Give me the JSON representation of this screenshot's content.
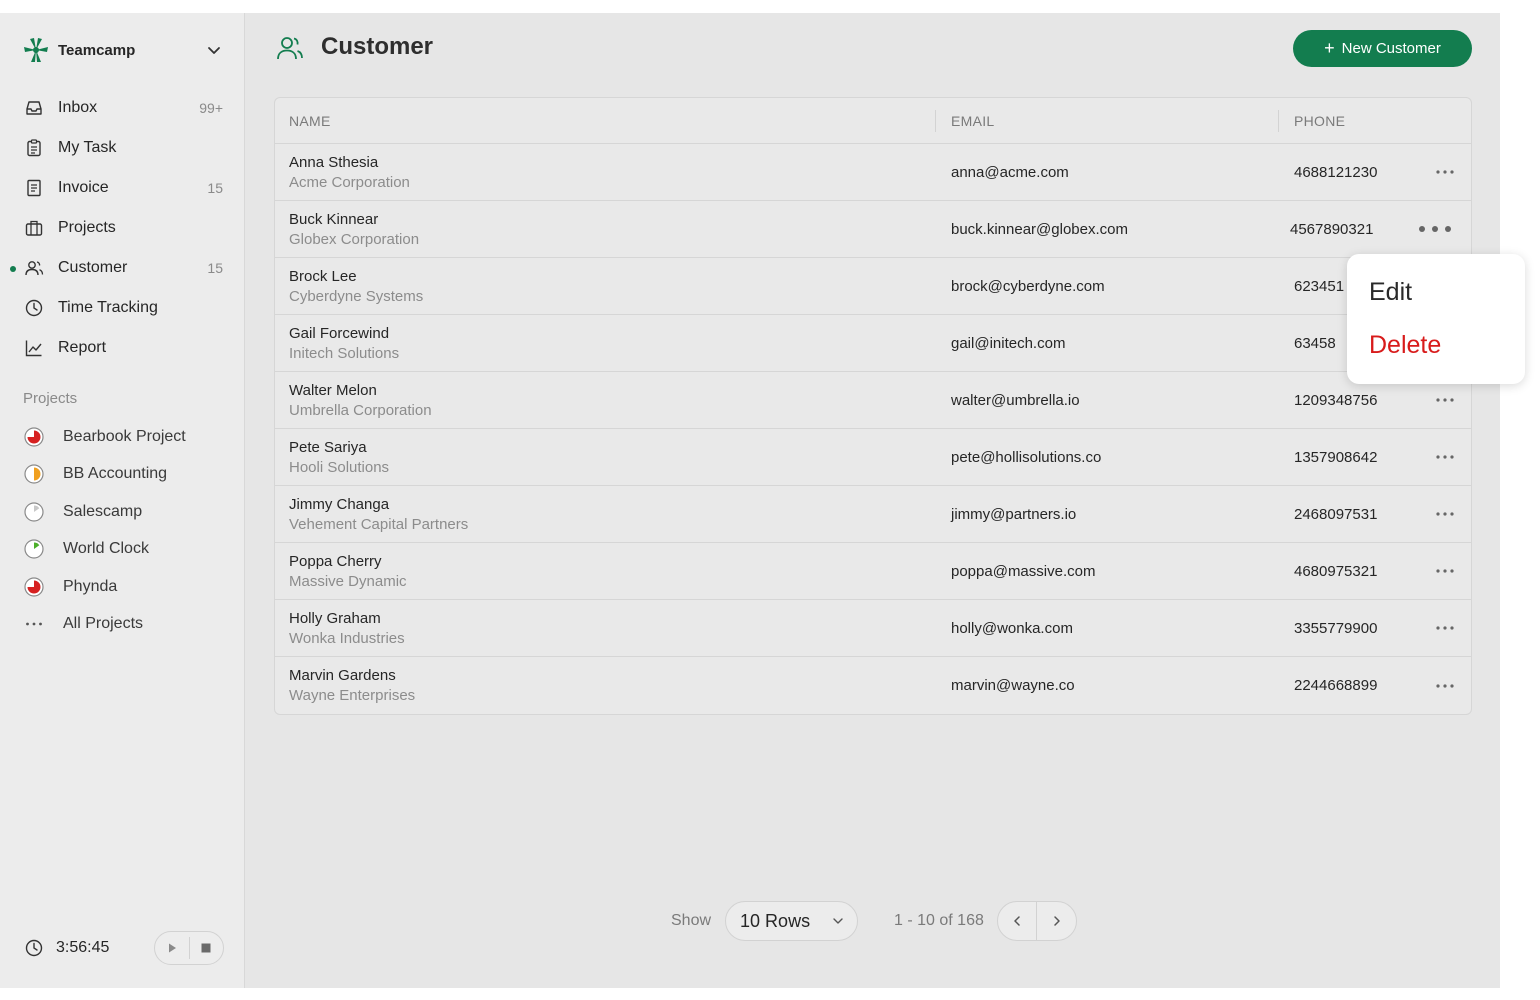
{
  "workspace": {
    "name": "Teamcamp"
  },
  "nav": [
    {
      "label": "Inbox",
      "count": "99+",
      "icon": "inbox-icon"
    },
    {
      "label": "My Task",
      "count": "",
      "icon": "clipboard-icon"
    },
    {
      "label": "Invoice",
      "count": "15",
      "icon": "invoice-icon"
    },
    {
      "label": "Projects",
      "count": "",
      "icon": "briefcase-icon"
    },
    {
      "label": "Customer",
      "count": "15",
      "icon": "users-icon",
      "active": true
    },
    {
      "label": "Time Tracking",
      "count": "",
      "icon": "clock-icon"
    },
    {
      "label": "Report",
      "count": "",
      "icon": "chart-line-icon"
    }
  ],
  "projects_section": {
    "title": "Projects",
    "items": [
      {
        "label": "Bearbook Project",
        "color": "#d62020",
        "progress": 0.75
      },
      {
        "label": "BB Accounting",
        "color": "#f0a020",
        "progress": 0.5
      },
      {
        "label": "Salescamp",
        "color": "#b0b0b0",
        "progress": 0.15
      },
      {
        "label": "World Clock",
        "color": "#4caf2a",
        "progress": 0.15
      },
      {
        "label": "Phynda",
        "color": "#d62020",
        "progress": 0.75
      }
    ],
    "all_label": "All Projects"
  },
  "timer": {
    "time": "3:56:45"
  },
  "page": {
    "title": "Customer",
    "new_button": "New Customer"
  },
  "table": {
    "columns": [
      "NAME",
      "EMAIL",
      "PHONE"
    ],
    "rows": [
      {
        "name": "Anna Sthesia",
        "company": "Acme Corporation",
        "email": "anna@acme.com",
        "phone": "4688121230"
      },
      {
        "name": "Buck Kinnear",
        "company": "Globex Corporation",
        "email": "buck.kinnear@globex.com",
        "phone": "4567890321"
      },
      {
        "name": "Brock Lee",
        "company": "Cyberdyne Systems",
        "email": "brock@cyberdyne.com",
        "phone": "623451"
      },
      {
        "name": "Gail Forcewind",
        "company": "Initech Solutions",
        "email": "gail@initech.com",
        "phone": "63458"
      },
      {
        "name": "Walter Melon",
        "company": "Umbrella Corporation",
        "email": "walter@umbrella.io",
        "phone": "1209348756"
      },
      {
        "name": "Pete Sariya",
        "company": "Hooli Solutions",
        "email": "pete@hollisolutions.co",
        "phone": "1357908642"
      },
      {
        "name": "Jimmy Changa",
        "company": "Vehement Capital Partners",
        "email": "jimmy@partners.io",
        "phone": "2468097531"
      },
      {
        "name": "Poppa Cherry",
        "company": "Massive Dynamic",
        "email": "poppa@massive.com",
        "phone": "4680975321"
      },
      {
        "name": "Holly Graham",
        "company": "Wonka Industries",
        "email": "holly@wonka.com",
        "phone": "3355779900"
      },
      {
        "name": "Marvin Gardens",
        "company": "Wayne Enterprises",
        "email": "marvin@wayne.co",
        "phone": "2244668899"
      }
    ]
  },
  "row_menu": {
    "edit": "Edit",
    "delete": "Delete"
  },
  "pagination": {
    "show_label": "Show",
    "rows_value": "10 Rows",
    "range": "1 - 10 of 168"
  },
  "colors": {
    "accent": "#137d4f",
    "danger": "#d81b1b"
  }
}
